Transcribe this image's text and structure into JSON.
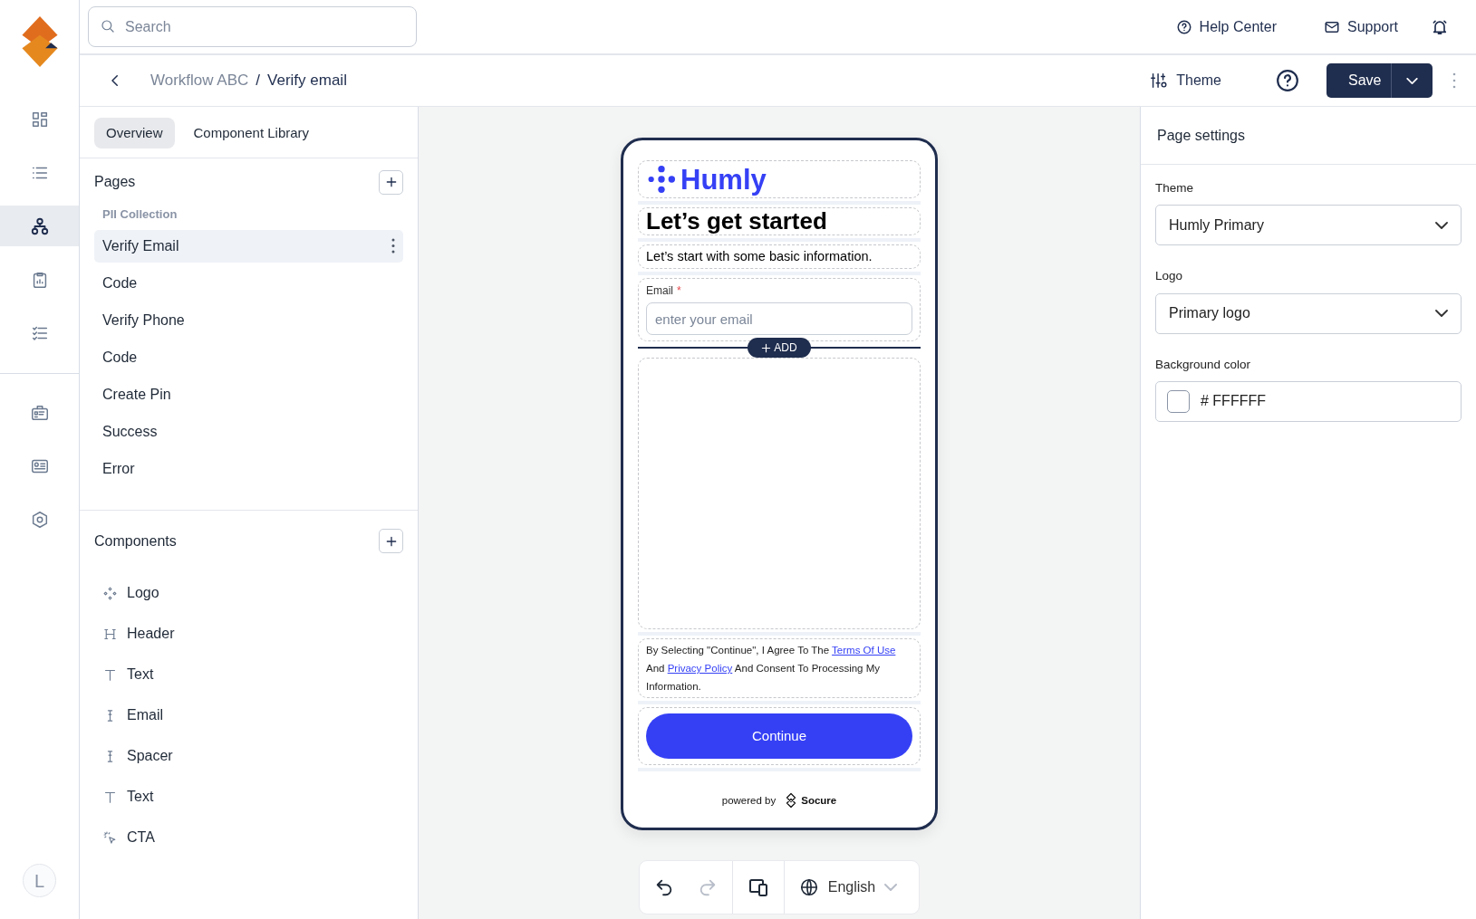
{
  "search": {
    "placeholder": "Search"
  },
  "top_links": [
    {
      "label": "Help Center",
      "kind": "help"
    },
    {
      "label": "Support",
      "kind": "mail"
    }
  ],
  "rail": {
    "groups": [
      {
        "items": [
          {
            "selected": false
          },
          {
            "selected": false
          },
          {
            "selected": true
          },
          {
            "selected": false
          },
          {
            "selected": false
          }
        ]
      },
      {
        "items": [
          {
            "selected": false
          },
          {
            "selected": false
          },
          {
            "selected": false
          }
        ]
      }
    ],
    "avatar": "L"
  },
  "breadcrumb": [
    {
      "label": "Workflow ABC",
      "current": false
    },
    {
      "label": "Verify email",
      "current": true
    }
  ],
  "breadcrumb_separator": "/",
  "toolbar": {
    "theme": "Theme",
    "save": "Save"
  },
  "panel_tabs": [
    {
      "label": "Overview",
      "selected": true
    },
    {
      "label": "Component Library",
      "selected": false
    }
  ],
  "pages": {
    "title": "Pages",
    "group": "PII Collection",
    "items": [
      {
        "label": "Verify Email",
        "selected": true
      },
      {
        "label": "Code",
        "selected": false
      },
      {
        "label": "Verify Phone",
        "selected": false
      },
      {
        "label": "Code",
        "selected": false
      },
      {
        "label": "Create Pin",
        "selected": false
      },
      {
        "label": "Success",
        "selected": false
      },
      {
        "label": "Error",
        "selected": false
      }
    ]
  },
  "components": {
    "title": "Components",
    "items": [
      {
        "label": "Logo",
        "kind": "logo"
      },
      {
        "label": "Header",
        "kind": "header"
      },
      {
        "label": "Text",
        "kind": "text"
      },
      {
        "label": "Email",
        "kind": "input"
      },
      {
        "label": "Spacer",
        "kind": "input"
      },
      {
        "label": "Text",
        "kind": "text"
      },
      {
        "label": "CTA",
        "kind": "cta"
      }
    ]
  },
  "preview": {
    "brand": "Humly",
    "heading": "Let’s get started",
    "subheading": "Let’s start with some basic information.",
    "email_label": "Email",
    "required": true,
    "required_mark": "*",
    "email_placeholder": "enter your email",
    "add": "ADD",
    "consent": [
      {
        "kind": "text",
        "text": "By Selecting \"Continue\", I Agree To The "
      },
      {
        "kind": "link",
        "text": "Terms Of Use"
      },
      {
        "kind": "text",
        "text": " And "
      },
      {
        "kind": "link",
        "text": "Privacy Policy"
      },
      {
        "kind": "text",
        "text": " And Consent To Processing My Information."
      }
    ],
    "cta": "Continue",
    "powered_by": "powered by",
    "powered_brand": "Socure"
  },
  "bottom_toolbar": {
    "undo": {
      "disabled": false
    },
    "redo": {
      "disabled": true
    },
    "language": "English"
  },
  "settings": {
    "title": "Page settings",
    "fields": [
      {
        "label": "Theme",
        "kind": "select",
        "value": "Humly Primary"
      },
      {
        "label": "Logo",
        "kind": "select",
        "value": "Primary logo"
      },
      {
        "label": "Background color",
        "kind": "color",
        "value": "# FFFFFF"
      }
    ]
  }
}
